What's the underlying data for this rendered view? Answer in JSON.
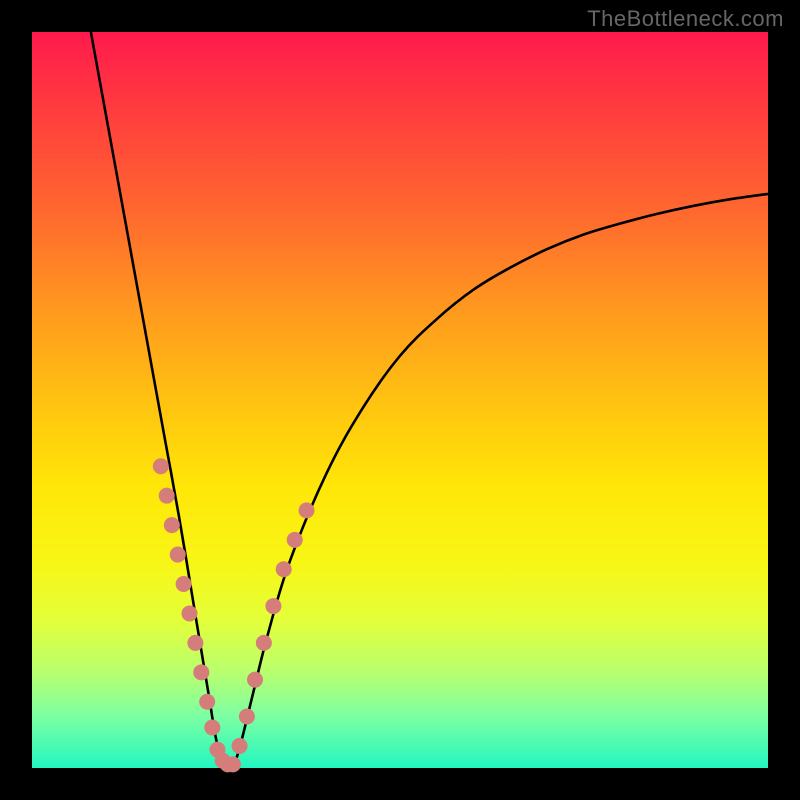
{
  "watermark": "TheBottleneck.com",
  "chart_data": {
    "type": "line",
    "title": "",
    "xlabel": "",
    "ylabel": "",
    "xlim": [
      0,
      100
    ],
    "ylim": [
      0,
      100
    ],
    "curve": {
      "name": "bottleneck-curve",
      "x": [
        8,
        10,
        12,
        14,
        16,
        18,
        20,
        22,
        24,
        25,
        26,
        27,
        28,
        30,
        32,
        35,
        40,
        45,
        50,
        55,
        60,
        65,
        70,
        75,
        80,
        85,
        90,
        95,
        100
      ],
      "y": [
        100,
        89,
        78,
        67,
        56,
        45,
        34,
        22,
        10,
        4,
        0.5,
        0.5,
        2,
        10,
        18,
        28,
        40,
        49,
        56,
        61,
        65,
        68,
        70.5,
        72.5,
        74,
        75.3,
        76.4,
        77.3,
        78
      ]
    },
    "markers_left": {
      "name": "left-arm-points",
      "color": "#d47d7a",
      "x": [
        17.5,
        18.3,
        19.0,
        19.8,
        20.6,
        21.4,
        22.2,
        23.0,
        23.8,
        24.5,
        25.2,
        25.9,
        26.6
      ],
      "y": [
        41,
        37,
        33,
        29,
        25,
        21,
        17,
        13,
        9,
        5.5,
        2.5,
        1,
        0.5
      ]
    },
    "markers_right": {
      "name": "right-arm-points",
      "color": "#d47d7a",
      "x": [
        27.3,
        28.2,
        29.2,
        30.3,
        31.5,
        32.8,
        34.2,
        35.7,
        37.3
      ],
      "y": [
        0.5,
        3,
        7,
        12,
        17,
        22,
        27,
        31,
        35
      ]
    },
    "gradient_colors": {
      "top": "#ff1a4d",
      "mid": "#ffe708",
      "bottom": "#22f7c0"
    }
  }
}
